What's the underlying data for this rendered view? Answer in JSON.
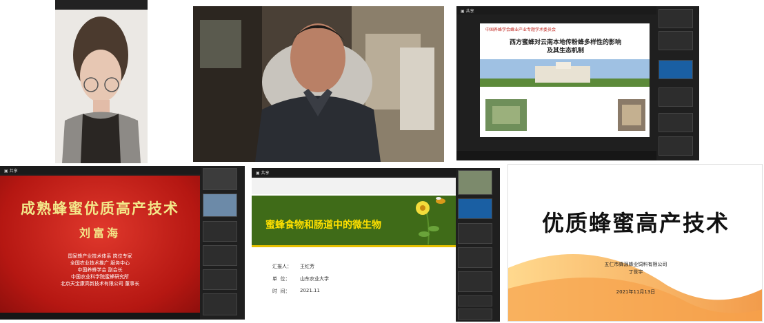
{
  "p1": {
    "overlay": ""
  },
  "p2": {
    "overlay": ""
  },
  "p3": {
    "header": "中国养蜂学会蜂业产业专题学术委员会",
    "title": "西方蜜蜂对云南本地传粉蜂多样性的影响及其生态机制",
    "speaker": "",
    "affil1": "",
    "affil2": "",
    "date": "",
    "thumbs": [
      "",
      "",
      "",
      "",
      ""
    ]
  },
  "p4": {
    "title": "成熟蜂蜜优质高产技术",
    "speaker": "刘富海",
    "lines": [
      "国家蜂产业技术体系 岗位专家",
      "全国农业技术推广 服务中心",
      "中国养蜂学会 副会长",
      "中国农业科学院蜜蜂研究所",
      "北京天宝康高新技术有限公司 董事长"
    ],
    "thumbs": [
      "",
      "",
      "",
      "",
      "",
      ""
    ]
  },
  "p5": {
    "title": "蜜蜂食物和肠道中的微生物",
    "reporter_label": "汇报人：",
    "reporter": "王红芳",
    "unit_label": "单  位：",
    "unit": "山东农业大学",
    "time_label": "时  间：",
    "time": "2021.11",
    "thumbs": [
      "",
      "",
      "",
      "",
      "",
      "",
      ""
    ]
  },
  "p6": {
    "title": "优质蜂蜜高产技术",
    "company": "五仁市蜂源蜂业饲料有限公司",
    "person": "丁世宇",
    "date": "2021年11月13日"
  },
  "colors": {
    "red_slide": "#c8201c",
    "green_bar": "#3f6b18",
    "gold_title": "#f3e88a",
    "dark_ui": "#1f1f1f"
  }
}
